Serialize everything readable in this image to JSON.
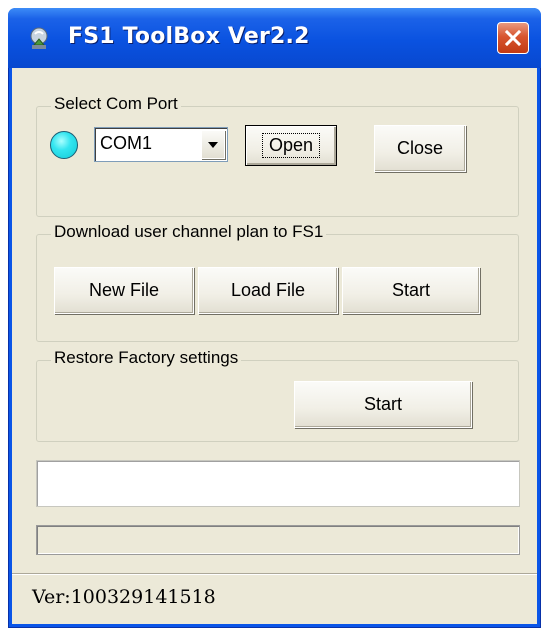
{
  "window": {
    "title": "FS1 ToolBox Ver2.2",
    "icon": "app-icon",
    "close_icon": "close-x-icon"
  },
  "com_port_group": {
    "label": "Select Com Port",
    "status_indicator_color": "#33e5f0",
    "combo": {
      "selected": "COM1",
      "dropdown_icon": "triangle-down-icon"
    },
    "open_label": "Open",
    "close_label": "Close"
  },
  "download_group": {
    "label": "Download user channel plan to FS1",
    "new_file_label": "New File",
    "load_file_label": "Load File",
    "start_label": "Start"
  },
  "restore_group": {
    "label": "Restore Factory settings",
    "start_label": "Start"
  },
  "log_field": {
    "value": ""
  },
  "progress": {
    "value": 0
  },
  "status_bar": {
    "text": "Ver:100329141518"
  },
  "colors": {
    "titlebar": "#0a52e0",
    "client_bg": "#ece9d8",
    "close_button": "#d8552f"
  }
}
